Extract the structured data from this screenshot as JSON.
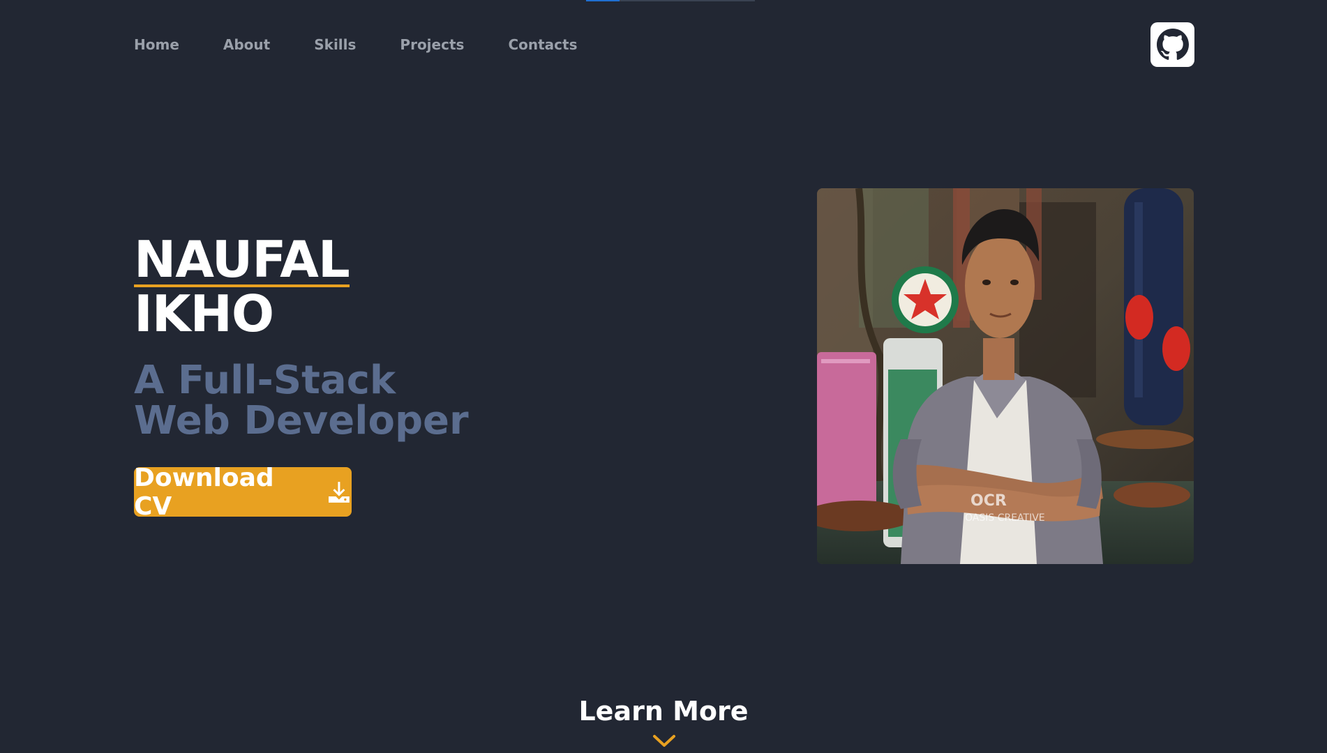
{
  "progress": {
    "fraction": 0.2,
    "color": "#1f6fd1"
  },
  "nav": {
    "items": [
      "Home",
      "About",
      "Skills",
      "Projects",
      "Contacts"
    ],
    "github_icon": "github-icon"
  },
  "hero": {
    "first_name": "NAUFAL",
    "last_name": "IKHO",
    "tagline_line1": "A Full-Stack",
    "tagline_line2": "Web Developer",
    "download_label": "Download CV",
    "download_icon": "download-icon",
    "photo_watermark_top": "OCR",
    "photo_watermark_bottom": "OASIS CREATIVE"
  },
  "learn_more": {
    "label": "Learn More",
    "icon": "chevron-down-icon"
  },
  "colors": {
    "background": "#222733",
    "accent": "#e8a121",
    "tagline": "#5b6d8f",
    "nav_text": "#9aa0aa"
  }
}
